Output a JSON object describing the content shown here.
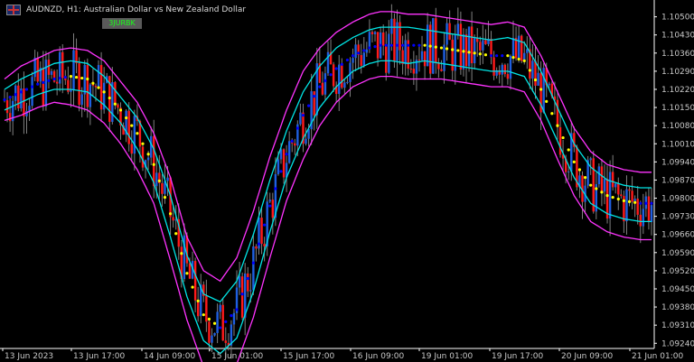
{
  "header": {
    "symbol_line": "AUDNZD, H1:  Australian Dollar vs New Zealand Dollar",
    "badge_text": "3JURBK"
  },
  "colors": {
    "background": "#000000",
    "bull_candle": "#1f5fe0",
    "bear_candle": "#ff1a1a",
    "wick": "#808080",
    "inner_band": "#00e5e5",
    "outer_band": "#ff33ff",
    "mid_dots_up": "#0000ff",
    "mid_dots_down": "#ffff00",
    "axis_text": "#c8c8c8",
    "badge_text": "#19ff19"
  },
  "chart_data": {
    "type": "line",
    "title": "AUDNZD, H1:  Australian Dollar vs New Zealand Dollar",
    "y_ticks": [
      "1.10500",
      "1.10430",
      "1.10360",
      "1.10290",
      "1.10220",
      "1.10150",
      "1.10080",
      "1.10010",
      "1.09940",
      "1.09870",
      "1.09800",
      "1.09730",
      "1.09660",
      "1.09590",
      "1.09520",
      "1.09450",
      "1.09380",
      "1.09310",
      "1.09240"
    ],
    "x_ticks": [
      "13 Jun 2023",
      "13 Jun 17:00",
      "14 Jun 09:00",
      "15 Jun 01:00",
      "15 Jun 17:00",
      "16 Jun 09:00",
      "19 Jun 01:00",
      "19 Jun 17:00",
      "20 Jun 09:00",
      "21 Jun 01:00"
    ],
    "ylim": [
      1.0922,
      1.1053
    ],
    "grid": false,
    "legend": "none",
    "series": [
      {
        "x": [
          0,
          6,
          12,
          18,
          24,
          30,
          36,
          42,
          48,
          54,
          60,
          66,
          72,
          78,
          84,
          90,
          96,
          102,
          108,
          114,
          120,
          126,
          132,
          136,
          140,
          146,
          152,
          158,
          164,
          170,
          176,
          182,
          188,
          194,
          200,
          206,
          212,
          218,
          224,
          230,
          234
        ],
        "values": [
          1.1018,
          1.1021,
          1.1024,
          1.1026,
          1.1027,
          1.1026,
          1.1021,
          1.1014,
          1.1005,
          1.0993,
          1.0974,
          1.0951,
          1.0935,
          1.093,
          1.0937,
          1.0955,
          1.0977,
          1.0997,
          1.1012,
          1.1023,
          1.103,
          1.1035,
          1.1038,
          1.1039,
          1.1039,
          1.1039,
          1.1039,
          1.1038,
          1.1037,
          1.1036,
          1.1035,
          1.1035,
          1.1033,
          1.1022,
          1.1008,
          1.0994,
          1.0985,
          1.0981,
          1.0979,
          1.0978,
          1.0978
        ]
      },
      {
        "x": [
          0,
          6,
          12,
          18,
          24,
          30,
          36,
          42,
          48,
          54,
          60,
          66,
          72,
          78,
          84,
          90,
          96,
          102,
          108,
          114,
          120,
          126,
          132,
          136,
          140,
          146,
          152,
          158,
          164,
          170,
          176,
          182,
          188,
          194,
          200,
          206,
          212,
          218,
          224,
          230,
          234
        ],
        "values": [
          1.1022,
          1.1026,
          1.1029,
          1.1032,
          1.1033,
          1.1032,
          1.1027,
          1.1019,
          1.1011,
          1.0999,
          1.0981,
          1.0958,
          1.0943,
          1.094,
          1.0948,
          1.0966,
          1.0987,
          1.1006,
          1.1021,
          1.1031,
          1.1038,
          1.1042,
          1.1045,
          1.1046,
          1.1046,
          1.1046,
          1.1045,
          1.1044,
          1.1043,
          1.1042,
          1.1041,
          1.1042,
          1.104,
          1.1029,
          1.1015,
          1.1001,
          1.0992,
          1.0987,
          1.0985,
          1.0984,
          1.0984
        ]
      },
      {
        "x": [
          0,
          6,
          12,
          18,
          24,
          30,
          36,
          42,
          48,
          54,
          60,
          66,
          72,
          78,
          84,
          90,
          96,
          102,
          108,
          114,
          120,
          126,
          132,
          136,
          140,
          146,
          152,
          158,
          164,
          170,
          176,
          182,
          188,
          194,
          200,
          206,
          212,
          218,
          224,
          230,
          234
        ],
        "values": [
          1.1014,
          1.1017,
          1.102,
          1.1022,
          1.1022,
          1.1021,
          1.1016,
          1.1009,
          1.0999,
          1.0986,
          1.0965,
          1.0942,
          1.0925,
          1.092,
          1.0926,
          1.0944,
          1.0967,
          1.0988,
          1.1003,
          1.1015,
          1.1023,
          1.1029,
          1.1032,
          1.1033,
          1.1033,
          1.1032,
          1.1033,
          1.1032,
          1.1031,
          1.103,
          1.1029,
          1.1029,
          1.1027,
          1.1016,
          1.1002,
          1.0988,
          1.0978,
          1.0974,
          1.0972,
          1.0971,
          1.0971
        ]
      },
      {
        "x": [
          0,
          6,
          12,
          18,
          24,
          30,
          36,
          42,
          48,
          54,
          60,
          66,
          72,
          78,
          84,
          90,
          96,
          102,
          108,
          114,
          120,
          126,
          132,
          136,
          140,
          146,
          152,
          158,
          164,
          170,
          176,
          182,
          188,
          194,
          200,
          206,
          212,
          218,
          224,
          230,
          234
        ],
        "values": [
          1.1026,
          1.1031,
          1.1034,
          1.1037,
          1.1038,
          1.1037,
          1.1033,
          1.1025,
          1.1017,
          1.1005,
          1.0988,
          1.0965,
          1.0952,
          1.0948,
          1.0957,
          1.0975,
          1.0996,
          1.1014,
          1.1029,
          1.1038,
          1.1044,
          1.1048,
          1.1051,
          1.1052,
          1.1052,
          1.1051,
          1.1051,
          1.105,
          1.1049,
          1.1048,
          1.1047,
          1.1048,
          1.1046,
          1.1035,
          1.1021,
          1.1007,
          1.0998,
          1.0993,
          1.0991,
          1.099,
          1.099
        ]
      },
      {
        "x": [
          0,
          6,
          12,
          18,
          24,
          30,
          36,
          42,
          48,
          54,
          60,
          66,
          72,
          78,
          84,
          90,
          96,
          102,
          108,
          114,
          120,
          126,
          132,
          136,
          140,
          146,
          152,
          158,
          164,
          170,
          176,
          182,
          188,
          194,
          200,
          206,
          212,
          218,
          224,
          230,
          234
        ],
        "values": [
          1.101,
          1.1012,
          1.1015,
          1.1017,
          1.1016,
          1.1014,
          1.1009,
          1.1001,
          1.0991,
          1.0978,
          1.0956,
          1.0933,
          1.0915,
          1.091,
          1.0916,
          1.0934,
          1.0957,
          1.0979,
          1.0995,
          1.1008,
          1.1017,
          1.1023,
          1.1026,
          1.1027,
          1.1027,
          1.1026,
          1.1026,
          1.1026,
          1.1025,
          1.1024,
          1.1023,
          1.1023,
          1.1021,
          1.101,
          1.0995,
          1.0981,
          1.0971,
          1.0967,
          1.0965,
          1.0964,
          1.0964
        ]
      }
    ],
    "candle_count": 235
  }
}
